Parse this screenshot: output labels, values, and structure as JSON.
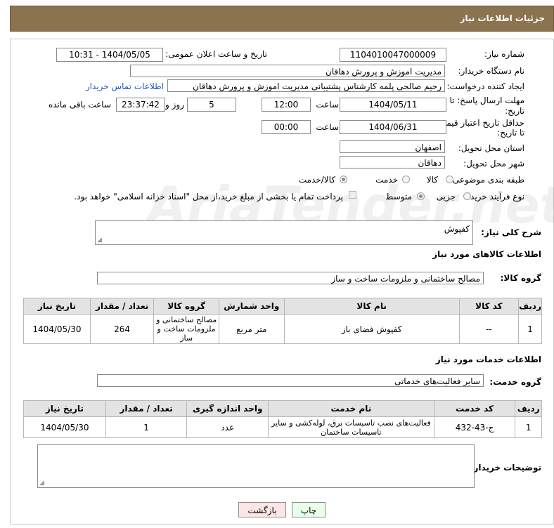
{
  "header": {
    "title": "جزئیات اطلاعات نیاز"
  },
  "form": {
    "need_number_label": "شماره نیاز:",
    "need_number": "1104010047000009",
    "announce_label": "تاریخ و ساعت اعلان عمومی:",
    "announce_value": "1404/05/05 - 10:31",
    "buyer_org_label": "نام دستگاه خریدار:",
    "buyer_org": "مدیریت اموزش و پرورش دهاقان",
    "creator_label": "ایجاد کننده درخواست:",
    "creator": "رحیم صالحی پلمه کارشناس پشتیبانی مدیریت اموزش و پرورش دهاقان",
    "contact_link": "اطلاعات تماس خریدار",
    "deadline_label_1": "مهلت ارسال پاسخ: تا",
    "deadline_label_2": "تاریخ:",
    "deadline_date": "1404/05/11",
    "time_label": "ساعت",
    "deadline_time": "12:00",
    "days_value": "5",
    "days_label": "روز و",
    "remaining_value": "23:37:42",
    "remaining_label": "ساعت باقی مانده",
    "validity_label_1": "حداقل تاریخ اعتبار قیمت:",
    "validity_label_2": "تا تاریخ:",
    "validity_date": "1404/06/31",
    "validity_time": "00:00",
    "province_label": "استان محل تحویل:",
    "province": "اصفهان",
    "city_label": "شهر محل تحویل:",
    "city": "دهاقان",
    "category_label": "طبقه بندی موضوعی:",
    "category_options": [
      "کالا",
      "خدمت",
      "کالا/خدمت"
    ],
    "category_selected": "کالا/خدمت",
    "process_label": "نوع فرآیند خرید :",
    "process_options": [
      "جزیی",
      "متوسط"
    ],
    "process_selected": "متوسط",
    "payment_note": "پرداخت تمام یا بخشی از مبلغ خرید،از محل \"اسناد خزانه اسلامی\" خواهد بود."
  },
  "description": {
    "label": "شرح کلی نیاز:",
    "value": "کفپوش"
  },
  "goods": {
    "section_title": "اطلاعات کالاهای مورد نیاز",
    "group_label": "گروه کالا:",
    "group_value": "مصالح ساختمانی و ملزومات ساخت و ساز",
    "columns": [
      "ردیف",
      "کد کالا",
      "نام کالا",
      "واحد شمارش",
      "گروه کالا",
      "تعداد / مقدار",
      "تاریخ نیاز"
    ],
    "rows": [
      [
        "1",
        "--",
        "کفپوش فضای باز",
        "متر مربع",
        "مصالح ساختمانی و ملزومات ساخت و ساز",
        "264",
        "1404/05/30"
      ]
    ]
  },
  "services": {
    "section_title": "اطلاعات خدمات مورد نیاز",
    "group_label": "گروه خدمت:",
    "group_value": "سایر فعالیت‌های خدماتی",
    "columns": [
      "ردیف",
      "کد خدمت",
      "نام خدمت",
      "واحد اندازه گیری",
      "تعداد / مقدار",
      "تاریخ نیاز"
    ],
    "rows": [
      [
        "1",
        "ج-43-432",
        "فعالیت‌های نصب تاسیسات برق، لوله‌کشی و سایر تاسیسات ساختمان",
        "عدد",
        "1",
        "1404/05/30"
      ]
    ]
  },
  "buyer_notes": {
    "label": "توضیحات خریدار:",
    "value": ""
  },
  "buttons": {
    "print": "چاپ",
    "back": "بازگشت"
  },
  "colors": {
    "header_bg": "#8b7350",
    "link": "#1a56c6",
    "print_btn": "#eaffea",
    "back_btn": "#ffe6e6"
  }
}
